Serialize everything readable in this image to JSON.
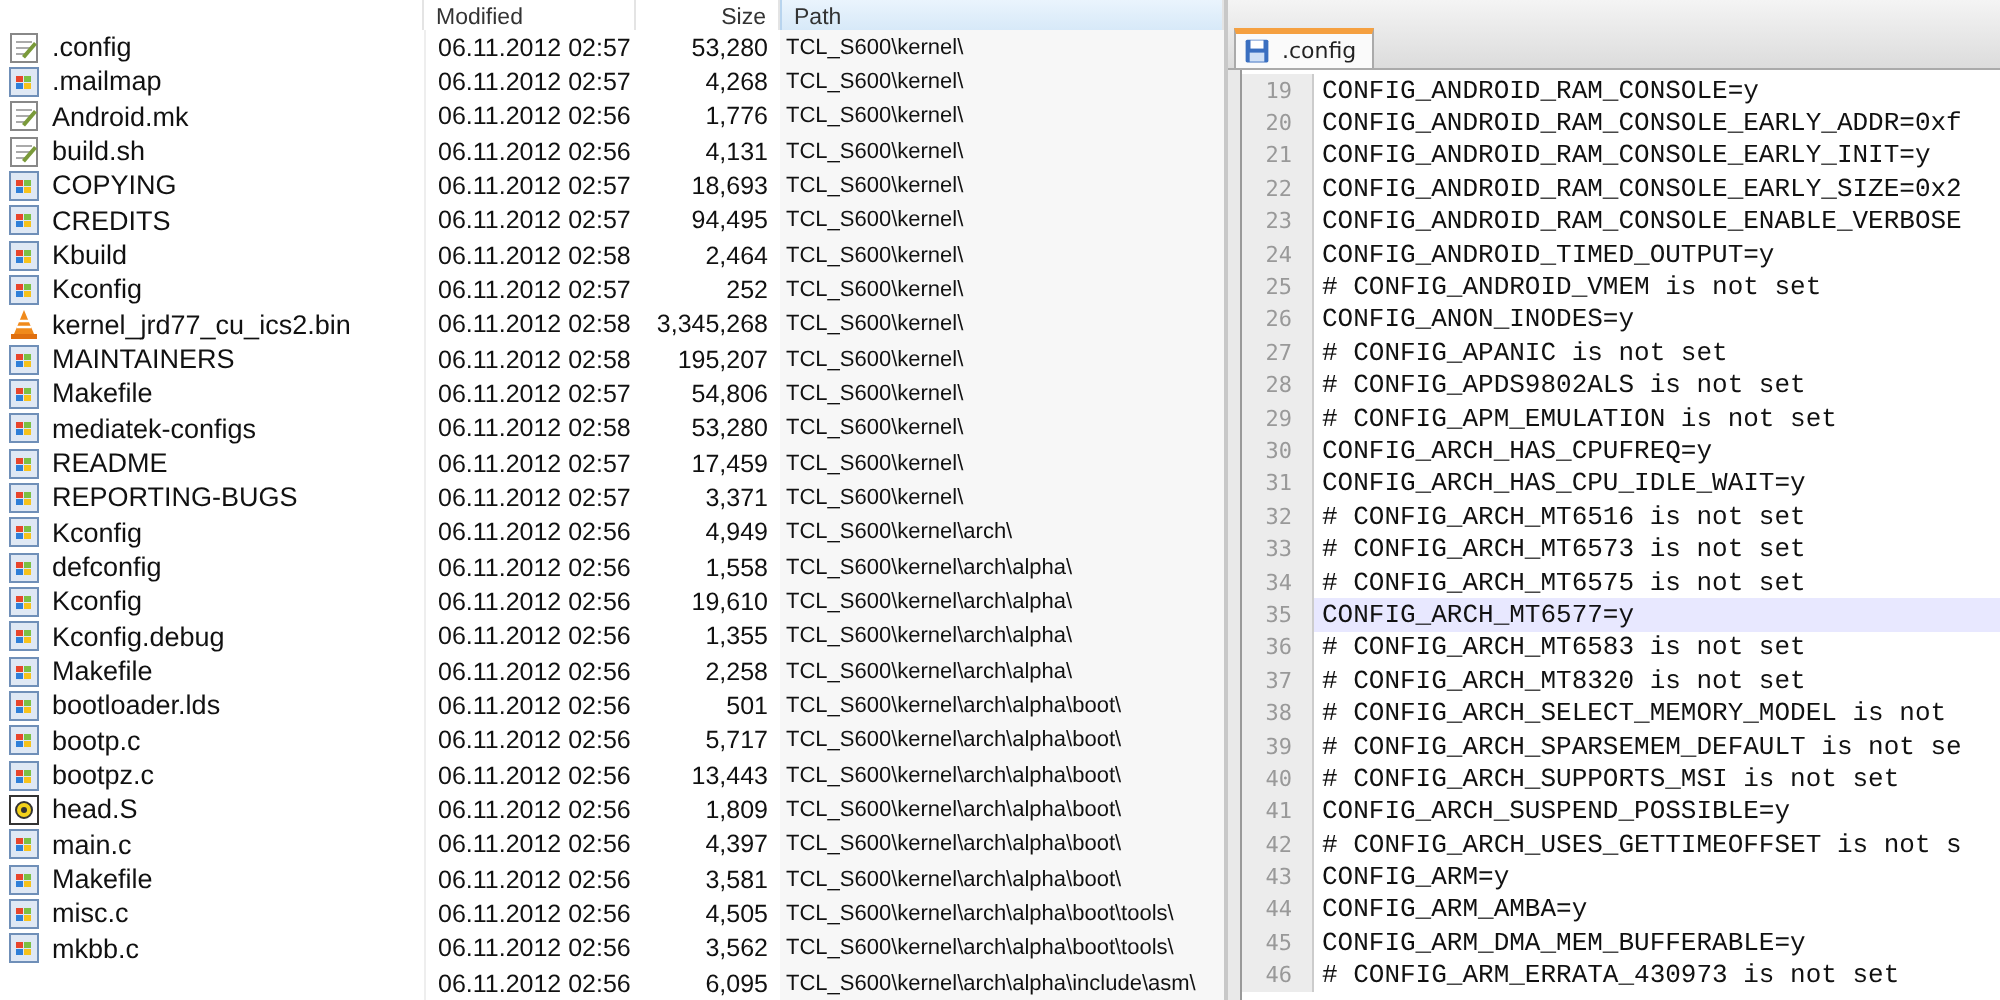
{
  "file_list": {
    "columns": [
      {
        "label": "Modified",
        "kind": "date",
        "sorted": false
      },
      {
        "label": "Size",
        "kind": "size",
        "sorted": false
      },
      {
        "label": "Path",
        "kind": "path",
        "sorted": true
      }
    ],
    "rows": [
      {
        "name": ".config",
        "kind": "text",
        "modified": "06.11.2012 02:57",
        "size": "53,280",
        "path": "TCL_S600\\kernel\\"
      },
      {
        "name": ".mailmap",
        "kind": "generic",
        "modified": "06.11.2012 02:57",
        "size": "4,268",
        "path": "TCL_S600\\kernel\\"
      },
      {
        "name": "Android.mk",
        "kind": "text",
        "modified": "06.11.2012 02:56",
        "size": "1,776",
        "path": "TCL_S600\\kernel\\"
      },
      {
        "name": "build.sh",
        "kind": "text",
        "modified": "06.11.2012 02:56",
        "size": "4,131",
        "path": "TCL_S600\\kernel\\"
      },
      {
        "name": "COPYING",
        "kind": "generic",
        "modified": "06.11.2012 02:57",
        "size": "18,693",
        "path": "TCL_S600\\kernel\\"
      },
      {
        "name": "CREDITS",
        "kind": "generic",
        "modified": "06.11.2012 02:57",
        "size": "94,495",
        "path": "TCL_S600\\kernel\\"
      },
      {
        "name": "Kbuild",
        "kind": "generic",
        "modified": "06.11.2012 02:58",
        "size": "2,464",
        "path": "TCL_S600\\kernel\\"
      },
      {
        "name": "Kconfig",
        "kind": "generic",
        "modified": "06.11.2012 02:57",
        "size": "252",
        "path": "TCL_S600\\kernel\\"
      },
      {
        "name": "kernel_jrd77_cu_ics2.bin",
        "kind": "cone",
        "modified": "06.11.2012 02:58",
        "size": "3,345,268",
        "path": "TCL_S600\\kernel\\"
      },
      {
        "name": "MAINTAINERS",
        "kind": "generic",
        "modified": "06.11.2012 02:58",
        "size": "195,207",
        "path": "TCL_S600\\kernel\\"
      },
      {
        "name": "Makefile",
        "kind": "generic",
        "modified": "06.11.2012 02:57",
        "size": "54,806",
        "path": "TCL_S600\\kernel\\"
      },
      {
        "name": "mediatek-configs",
        "kind": "generic",
        "modified": "06.11.2012 02:58",
        "size": "53,280",
        "path": "TCL_S600\\kernel\\"
      },
      {
        "name": "README",
        "kind": "generic",
        "modified": "06.11.2012 02:57",
        "size": "17,459",
        "path": "TCL_S600\\kernel\\"
      },
      {
        "name": "REPORTING-BUGS",
        "kind": "generic",
        "modified": "06.11.2012 02:57",
        "size": "3,371",
        "path": "TCL_S600\\kernel\\"
      },
      {
        "name": "Kconfig",
        "kind": "generic",
        "modified": "06.11.2012 02:56",
        "size": "4,949",
        "path": "TCL_S600\\kernel\\arch\\"
      },
      {
        "name": "defconfig",
        "kind": "generic",
        "modified": "06.11.2012 02:56",
        "size": "1,558",
        "path": "TCL_S600\\kernel\\arch\\alpha\\"
      },
      {
        "name": "Kconfig",
        "kind": "generic",
        "modified": "06.11.2012 02:56",
        "size": "19,610",
        "path": "TCL_S600\\kernel\\arch\\alpha\\"
      },
      {
        "name": "Kconfig.debug",
        "kind": "generic",
        "modified": "06.11.2012 02:56",
        "size": "1,355",
        "path": "TCL_S600\\kernel\\arch\\alpha\\"
      },
      {
        "name": "Makefile",
        "kind": "generic",
        "modified": "06.11.2012 02:56",
        "size": "2,258",
        "path": "TCL_S600\\kernel\\arch\\alpha\\"
      },
      {
        "name": "bootloader.lds",
        "kind": "generic",
        "modified": "06.11.2012 02:56",
        "size": "501",
        "path": "TCL_S600\\kernel\\arch\\alpha\\boot\\"
      },
      {
        "name": "bootp.c",
        "kind": "generic",
        "modified": "06.11.2012 02:56",
        "size": "5,717",
        "path": "TCL_S600\\kernel\\arch\\alpha\\boot\\"
      },
      {
        "name": "bootpz.c",
        "kind": "generic",
        "modified": "06.11.2012 02:56",
        "size": "13,443",
        "path": "TCL_S600\\kernel\\arch\\alpha\\boot\\"
      },
      {
        "name": "head.S",
        "kind": "gear",
        "modified": "06.11.2012 02:56",
        "size": "1,809",
        "path": "TCL_S600\\kernel\\arch\\alpha\\boot\\"
      },
      {
        "name": "main.c",
        "kind": "generic",
        "modified": "06.11.2012 02:56",
        "size": "4,397",
        "path": "TCL_S600\\kernel\\arch\\alpha\\boot\\"
      },
      {
        "name": "Makefile",
        "kind": "generic",
        "modified": "06.11.2012 02:56",
        "size": "3,581",
        "path": "TCL_S600\\kernel\\arch\\alpha\\boot\\"
      },
      {
        "name": "misc.c",
        "kind": "generic",
        "modified": "06.11.2012 02:56",
        "size": "4,505",
        "path": "TCL_S600\\kernel\\arch\\alpha\\boot\\tools\\"
      },
      {
        "name": "mkbb.c",
        "kind": "generic",
        "modified": "06.11.2012 02:56",
        "size": "3,562",
        "path": "TCL_S600\\kernel\\arch\\alpha\\boot\\tools\\"
      },
      {
        "modified": "06.11.2012 02:56",
        "size": "6,095",
        "path": "TCL_S600\\kernel\\arch\\alpha\\include\\asm\\"
      }
    ]
  },
  "editor": {
    "tabs": [
      {
        "label": ".config",
        "selected": true
      }
    ],
    "lines": [
      {
        "number": "19",
        "text": "CONFIG_ANDROID_RAM_CONSOLE=y",
        "highlighted": false
      },
      {
        "number": "20",
        "text": "CONFIG_ANDROID_RAM_CONSOLE_EARLY_ADDR=0xf",
        "highlighted": false
      },
      {
        "number": "21",
        "text": "CONFIG_ANDROID_RAM_CONSOLE_EARLY_INIT=y",
        "highlighted": false
      },
      {
        "number": "22",
        "text": "CONFIG_ANDROID_RAM_CONSOLE_EARLY_SIZE=0x2",
        "highlighted": false
      },
      {
        "number": "23",
        "text": "CONFIG_ANDROID_RAM_CONSOLE_ENABLE_VERBOSE",
        "highlighted": false
      },
      {
        "number": "24",
        "text": "CONFIG_ANDROID_TIMED_OUTPUT=y",
        "highlighted": false
      },
      {
        "number": "25",
        "text": "# CONFIG_ANDROID_VMEM is not set",
        "highlighted": false
      },
      {
        "number": "26",
        "text": "CONFIG_ANON_INODES=y",
        "highlighted": false
      },
      {
        "number": "27",
        "text": "# CONFIG_APANIC is not set",
        "highlighted": false
      },
      {
        "number": "28",
        "text": "# CONFIG_APDS9802ALS is not set",
        "highlighted": false
      },
      {
        "number": "29",
        "text": "# CONFIG_APM_EMULATION is not set",
        "highlighted": false
      },
      {
        "number": "30",
        "text": "CONFIG_ARCH_HAS_CPUFREQ=y",
        "highlighted": false
      },
      {
        "number": "31",
        "text": "CONFIG_ARCH_HAS_CPU_IDLE_WAIT=y",
        "highlighted": false
      },
      {
        "number": "32",
        "text": "# CONFIG_ARCH_MT6516 is not set",
        "highlighted": false
      },
      {
        "number": "33",
        "text": "# CONFIG_ARCH_MT6573 is not set",
        "highlighted": false
      },
      {
        "number": "34",
        "text": "# CONFIG_ARCH_MT6575 is not set",
        "highlighted": false
      },
      {
        "number": "35",
        "text": "CONFIG_ARCH_MT6577=y",
        "highlighted": true
      },
      {
        "number": "36",
        "text": "# CONFIG_ARCH_MT6583 is not set",
        "highlighted": false
      },
      {
        "number": "37",
        "text": "# CONFIG_ARCH_MT8320 is not set",
        "highlighted": false
      },
      {
        "number": "38",
        "text": "# CONFIG_ARCH_SELECT_MEMORY_MODEL is not",
        "highlighted": false
      },
      {
        "number": "39",
        "text": "# CONFIG_ARCH_SPARSEMEM_DEFAULT is not se",
        "highlighted": false
      },
      {
        "number": "40",
        "text": "# CONFIG_ARCH_SUPPORTS_MSI is not set",
        "highlighted": false
      },
      {
        "number": "41",
        "text": "CONFIG_ARCH_SUSPEND_POSSIBLE=y",
        "highlighted": false
      },
      {
        "number": "42",
        "text": "# CONFIG_ARCH_USES_GETTIMEOFFSET is not s",
        "highlighted": false
      },
      {
        "number": "43",
        "text": "CONFIG_ARM=y",
        "highlighted": false
      },
      {
        "number": "44",
        "text": "CONFIG_ARM_AMBA=y",
        "highlighted": false
      },
      {
        "number": "45",
        "text": "CONFIG_ARM_DMA_MEM_BUFFERABLE=y",
        "highlighted": false
      },
      {
        "number": "46",
        "text": "# CONFIG_ARM_ERRATA_430973 is not set",
        "highlighted": false
      }
    ]
  }
}
